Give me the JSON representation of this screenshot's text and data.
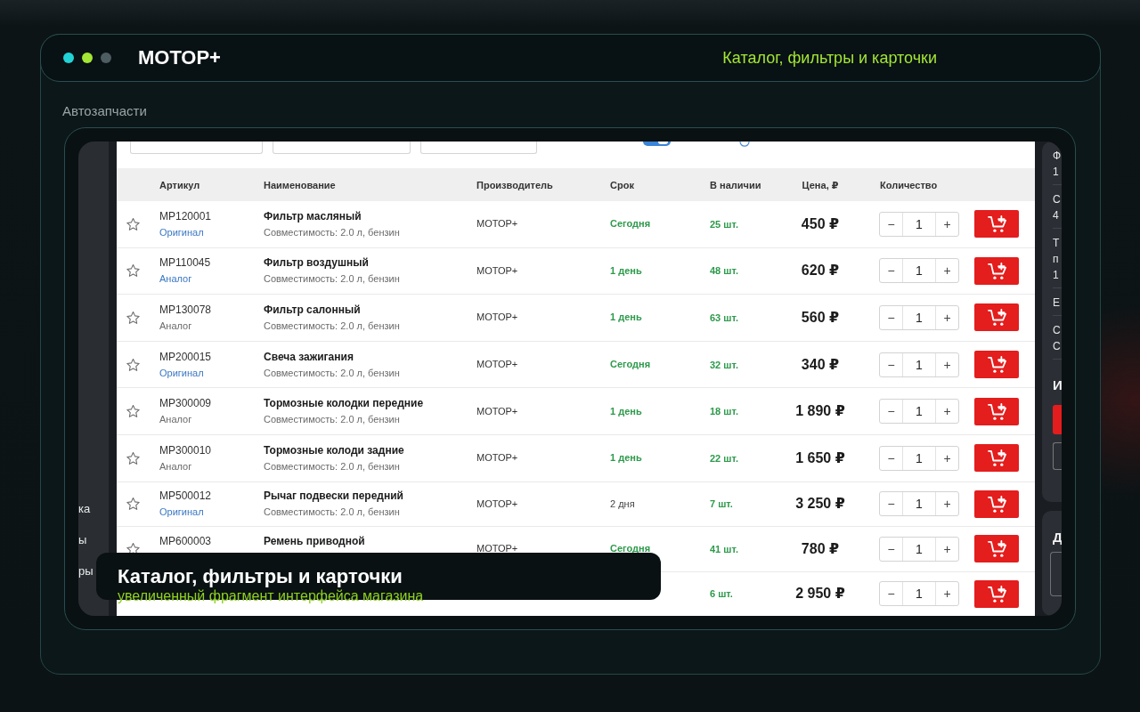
{
  "window": {
    "dots": [
      {
        "color": "#22d3d6"
      },
      {
        "color": "#a3e635"
      },
      {
        "color": "#4d5d62"
      }
    ],
    "title": "МОТОР+",
    "subtitle": "Каталог, фильтры и карточки"
  },
  "section_label": "Автозапчасти",
  "screenshot": {
    "sidebar": {
      "items": [
        "ка",
        "ы",
        "ры"
      ]
    },
    "filters": {
      "stock_toggle": {
        "on": true
      }
    },
    "table": {
      "columns": [
        "Артикул",
        "Наименование",
        "Производитель",
        "Срок",
        "В наличии",
        "Цена, ₽",
        "Количество"
      ],
      "rows": [
        {
          "favorite": false,
          "article": "MP120001",
          "type": {
            "text": "Оригинал",
            "link": true
          },
          "name": "Фильтр масляный",
          "compatibility": "Совместимость: 2.0 л, бензин",
          "maker": "МОТОР+",
          "term": {
            "text": "Сегодня",
            "accent": true
          },
          "stock": "25 шт.",
          "price": "450 ₽",
          "stepper": {
            "minus": "−",
            "value": "1",
            "plus": "+"
          }
        },
        {
          "favorite": false,
          "article": "MP110045",
          "type": {
            "text": "Аналог",
            "link": true
          },
          "name": "Фильтр воздушный",
          "compatibility": "Совместимость: 2.0 л, бензин",
          "maker": "МОТОР+",
          "term": {
            "text": "1 день",
            "accent": true
          },
          "stock": "48 шт.",
          "price": "620 ₽",
          "stepper": {
            "minus": "−",
            "value": "1",
            "plus": "+"
          }
        },
        {
          "favorite": false,
          "article": "MP130078",
          "type": {
            "text": "Аналог",
            "link": false
          },
          "name": "Фильтр салонный",
          "compatibility": "Совместимость: 2.0 л, бензин",
          "maker": "МОТОР+",
          "term": {
            "text": "1 день",
            "accent": true
          },
          "stock": "63 шт.",
          "price": "560 ₽",
          "stepper": {
            "minus": "−",
            "value": "1",
            "plus": "+"
          }
        },
        {
          "favorite": false,
          "article": "MP200015",
          "type": {
            "text": "Оригинал",
            "link": true
          },
          "name": "Свеча зажигания",
          "compatibility": "Совместимость: 2.0 л, бензин",
          "maker": "МОТОР+",
          "term": {
            "text": "Сегодня",
            "accent": true
          },
          "stock": "32 шт.",
          "price": "340 ₽",
          "stepper": {
            "minus": "−",
            "value": "1",
            "plus": "+"
          }
        },
        {
          "favorite": false,
          "article": "MP300009",
          "type": {
            "text": "Аналог",
            "link": false
          },
          "name": "Тормозные колодки передние",
          "compatibility": "Совместимость: 2.0 л, бензин",
          "maker": "МОТОР+",
          "term": {
            "text": "1 день",
            "accent": true
          },
          "stock": "18 шт.",
          "price": "1 890 ₽",
          "stepper": {
            "minus": "−",
            "value": "1",
            "plus": "+"
          }
        },
        {
          "favorite": false,
          "article": "MP300010",
          "type": {
            "text": "Аналог",
            "link": false
          },
          "name": "Тормозные колоди задние",
          "compatibility": "Совместимость: 2.0 л, бензин",
          "maker": "МОТОР+",
          "term": {
            "text": "1 день",
            "accent": true
          },
          "stock": "22 шт.",
          "price": "1 650 ₽",
          "stepper": {
            "minus": "−",
            "value": "1",
            "plus": "+"
          }
        },
        {
          "favorite": false,
          "article": "MP500012",
          "type": {
            "text": "Оригинал",
            "link": true
          },
          "name": "Рычаг подвески передний",
          "compatibility": "Совместимость: 2.0 л, бензин",
          "maker": "МОТОР+",
          "term": {
            "text": "2 дня",
            "accent": false
          },
          "stock": "7 шт.",
          "price": "3 250 ₽",
          "stepper": {
            "minus": "−",
            "value": "1",
            "plus": "+"
          }
        },
        {
          "favorite": false,
          "article": "MP600003",
          "name": "Ремень приводной",
          "maker": "МОТОР+",
          "term": {
            "text": "Сегодня",
            "accent": true
          },
          "stock": "41 шт.",
          "price": "780 ₽",
          "stepper": {
            "minus": "−",
            "value": "1",
            "plus": "+"
          }
        },
        {
          "stock": "6 шт.",
          "price": "2 950 ₽",
          "stepper": {
            "minus": "−",
            "value": "1",
            "plus": "+"
          }
        }
      ]
    },
    "side_panel": {
      "blocks": [
        [
          "Ф",
          "1"
        ],
        [
          "С",
          "4"
        ],
        [
          "Т",
          "п",
          "1"
        ],
        [
          "Е"
        ],
        [
          "С",
          "С"
        ]
      ],
      "heading": "И",
      "buttons": [
        {
          "kind": "primary"
        },
        {
          "kind": "secondary"
        }
      ],
      "card_2": {
        "heading": "Д"
      }
    }
  },
  "caption": {
    "title": "Каталог, фильтры и карточки",
    "subtitle": "увеличенный фрагмент интерфейса магазина"
  }
}
